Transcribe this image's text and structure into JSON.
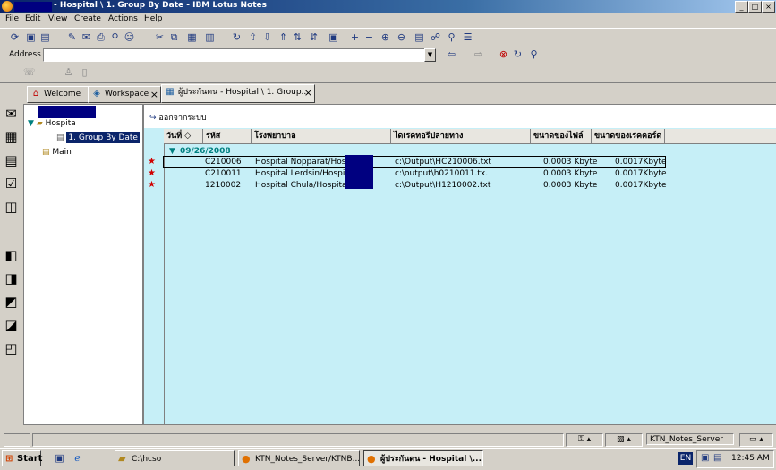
{
  "window": {
    "title": "- Hospital \\ 1. Group By Date - IBM Lotus Notes",
    "buttons": {
      "minimize": "_",
      "maximize": "□",
      "close": "×"
    }
  },
  "menu": [
    "File",
    "Edit",
    "View",
    "Create",
    "Actions",
    "Help"
  ],
  "address": {
    "label": "Address",
    "value": ""
  },
  "tabs": [
    {
      "label": "Welcome",
      "icon": "home-icon"
    },
    {
      "label": "Workspace",
      "icon": "workspace-icon"
    },
    {
      "label": "ผู้ประกันตน - Hospital \\ 1. Group...",
      "icon": "database-icon"
    }
  ],
  "nav": {
    "folder": "Hospita",
    "items": [
      {
        "label": "1. Group By Date",
        "selected": true
      },
      {
        "label": "Main",
        "selected": false
      }
    ]
  },
  "view": {
    "action": "ออกจากระบบ",
    "columns": [
      "วันที่",
      "รหัส",
      "โรงพยาบาล",
      "ไดเรคทอรีปลายทาง",
      "ขนาดของไฟล์",
      "ขนาดของเรคคอร์ด"
    ],
    "group": "09/26/2008",
    "rows": [
      {
        "code": "C210006",
        "hospital": "Hospital Nopparat/Hospital",
        "path": "c:\\Output\\HC210006.txt",
        "filesize": "0.0003 Kbyte",
        "recsize": "0.0017Kbyte"
      },
      {
        "code": "C210011",
        "hospital": "Hospital Lerdsin/Hospital",
        "path": "c:\\output\\h0210011.tx.",
        "filesize": "0.0003 Kbyte",
        "recsize": "0.0017Kbyte"
      },
      {
        "code": "1210002",
        "hospital": "Hospital Chula/Hospital/1",
        "path": "c:\\Output\\H1210002.txt",
        "filesize": "0.0003 Kbyte",
        "recsize": "0.0017Kbyte"
      }
    ]
  },
  "status": {
    "server": "KTN_Notes_Server"
  },
  "taskbar": {
    "start": "Start",
    "tasks": [
      {
        "label": "C:\\hcso"
      },
      {
        "label": "KTN_Notes_Server/KTNB..."
      },
      {
        "label": "ผู้ประกันตน - Hospital \\..."
      }
    ],
    "lang": "EN",
    "clock": "12:45 AM"
  }
}
